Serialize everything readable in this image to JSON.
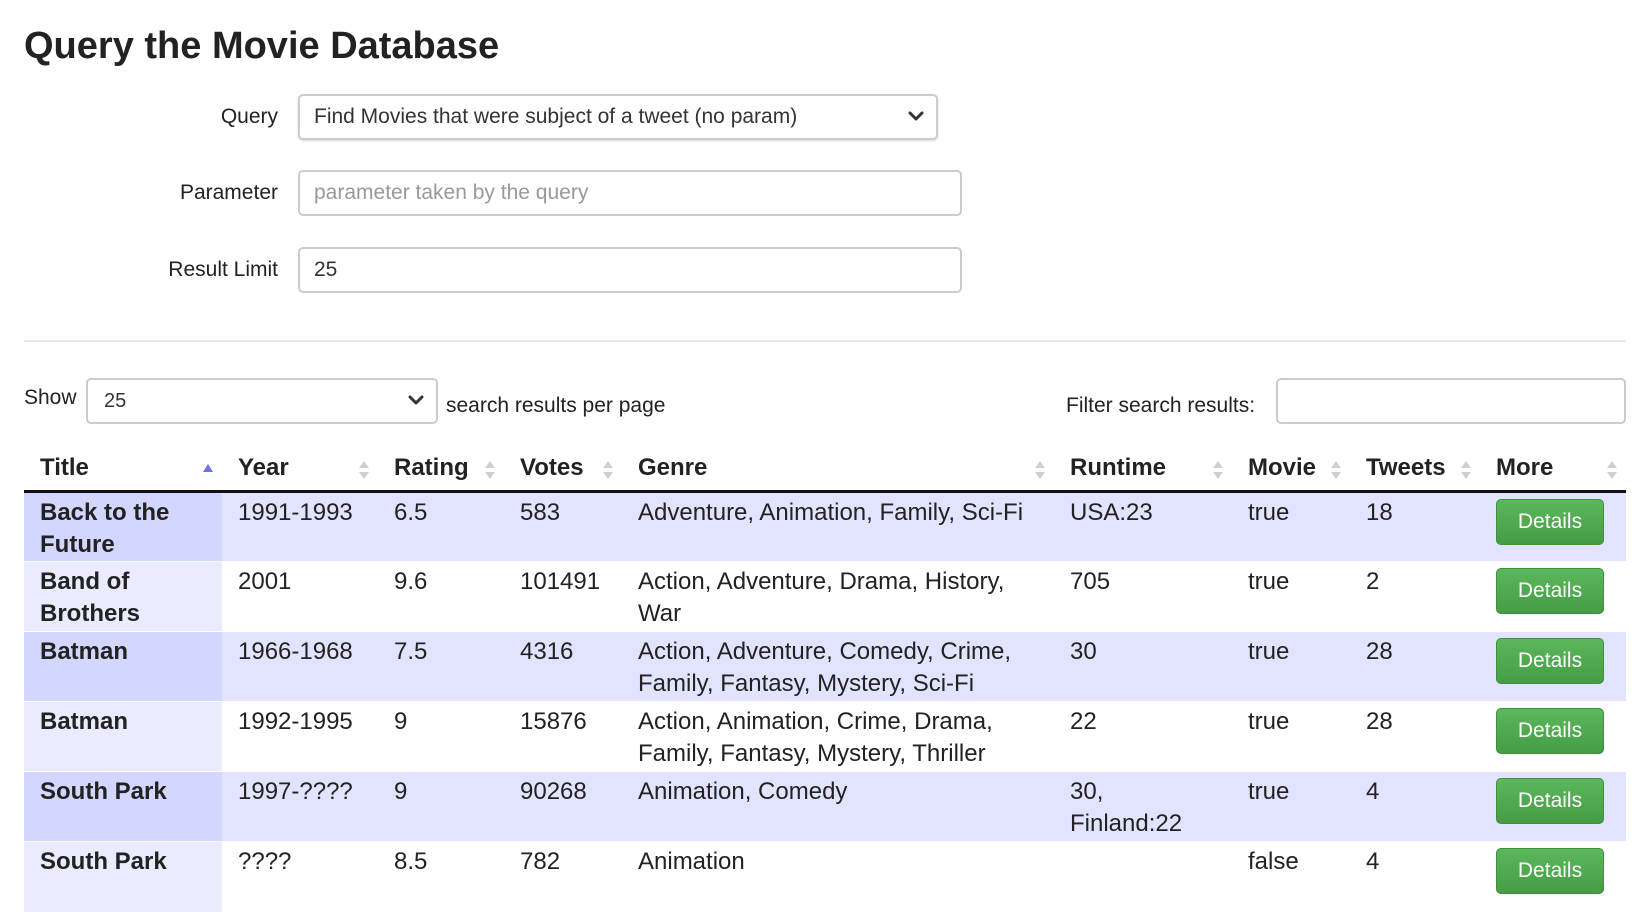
{
  "page_title": "Query the Movie Database",
  "form": {
    "query_label": "Query",
    "query_value": "Find Movies that were subject of a tweet (no param)",
    "parameter_label": "Parameter",
    "parameter_placeholder": "parameter taken by the query",
    "limit_label": "Result Limit",
    "limit_value": "25"
  },
  "table_controls": {
    "show_label": "Show",
    "page_size": "25",
    "per_page_label": "search results per page",
    "filter_label": "Filter search results:",
    "filter_value": ""
  },
  "table": {
    "columns": [
      "Title",
      "Year",
      "Rating",
      "Votes",
      "Genre",
      "Runtime",
      "Movie",
      "Tweets",
      "More"
    ],
    "sorted_column": "Title",
    "sort_direction": "ascending",
    "rows": [
      {
        "title": "Back to the Future",
        "year": "1991-1993",
        "rating": "6.5",
        "votes": "583",
        "genre": "Adventure, Animation, Family, Sci-Fi",
        "runtime": "USA:23",
        "movie": "true",
        "tweets": "18",
        "more": "Details"
      },
      {
        "title": "Band of Brothers",
        "year": "2001",
        "rating": "9.6",
        "votes": "101491",
        "genre": "Action, Adventure, Drama, History, War",
        "runtime": "705",
        "movie": "true",
        "tweets": "2",
        "more": "Details"
      },
      {
        "title": "Batman",
        "year": "1966-1968",
        "rating": "7.5",
        "votes": "4316",
        "genre": "Action, Adventure, Comedy, Crime, Family, Fantasy, Mystery, Sci-Fi",
        "runtime": "30",
        "movie": "true",
        "tweets": "28",
        "more": "Details"
      },
      {
        "title": "Batman",
        "year": "1992-1995",
        "rating": "9",
        "votes": "15876",
        "genre": "Action, Animation, Crime, Drama, Family, Fantasy, Mystery, Thriller",
        "runtime": "22",
        "movie": "true",
        "tweets": "28",
        "more": "Details"
      },
      {
        "title": "South Park",
        "year": "1997-????",
        "rating": "9",
        "votes": "90268",
        "genre": "Animation, Comedy",
        "runtime": "30, Finland:22",
        "movie": "true",
        "tweets": "4",
        "more": "Details"
      },
      {
        "title": "South Park",
        "year": "????",
        "rating": "8.5",
        "votes": "782",
        "genre": "Animation",
        "runtime": "",
        "movie": "false",
        "tweets": "4",
        "more": "Details"
      }
    ]
  },
  "colors": {
    "odd_row": "#e2e4ff",
    "even_row": "#ffffff",
    "sorted_odd": "#d3d6ff",
    "sorted_even": "#eaebff",
    "details_button": "#5cb85c",
    "sort_active": "#6b74e0"
  },
  "icons": {
    "select_chevron": "chevron-down-icon",
    "sort_asc": "sort-asc-icon",
    "sort_both": "sort-both-icon"
  }
}
